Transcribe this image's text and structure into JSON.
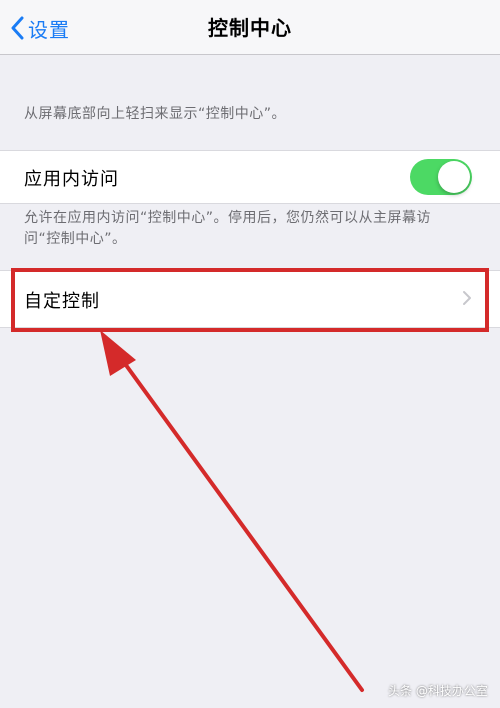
{
  "navbar": {
    "back_label": "设置",
    "title": "控制中心"
  },
  "top_description": "从屏幕底部向上轻扫来显示“控制中心”。",
  "access_within_apps": {
    "label": "应用内访问",
    "toggle_on": true,
    "description": "允许在应用内访问“控制中心”。停用后，您仍然可以从主屏幕访问“控制中心”。"
  },
  "customize_controls": {
    "label": "自定控制"
  },
  "watermark": "头条 @科技办公室",
  "colors": {
    "background": "#efeff4",
    "ios_blue": "#1a7cf5",
    "toggle_green": "#4cd964",
    "annotation_red": "#d42a2a"
  },
  "icons": {
    "back": "chevron-left-icon",
    "disclosure": "chevron-right-icon"
  }
}
